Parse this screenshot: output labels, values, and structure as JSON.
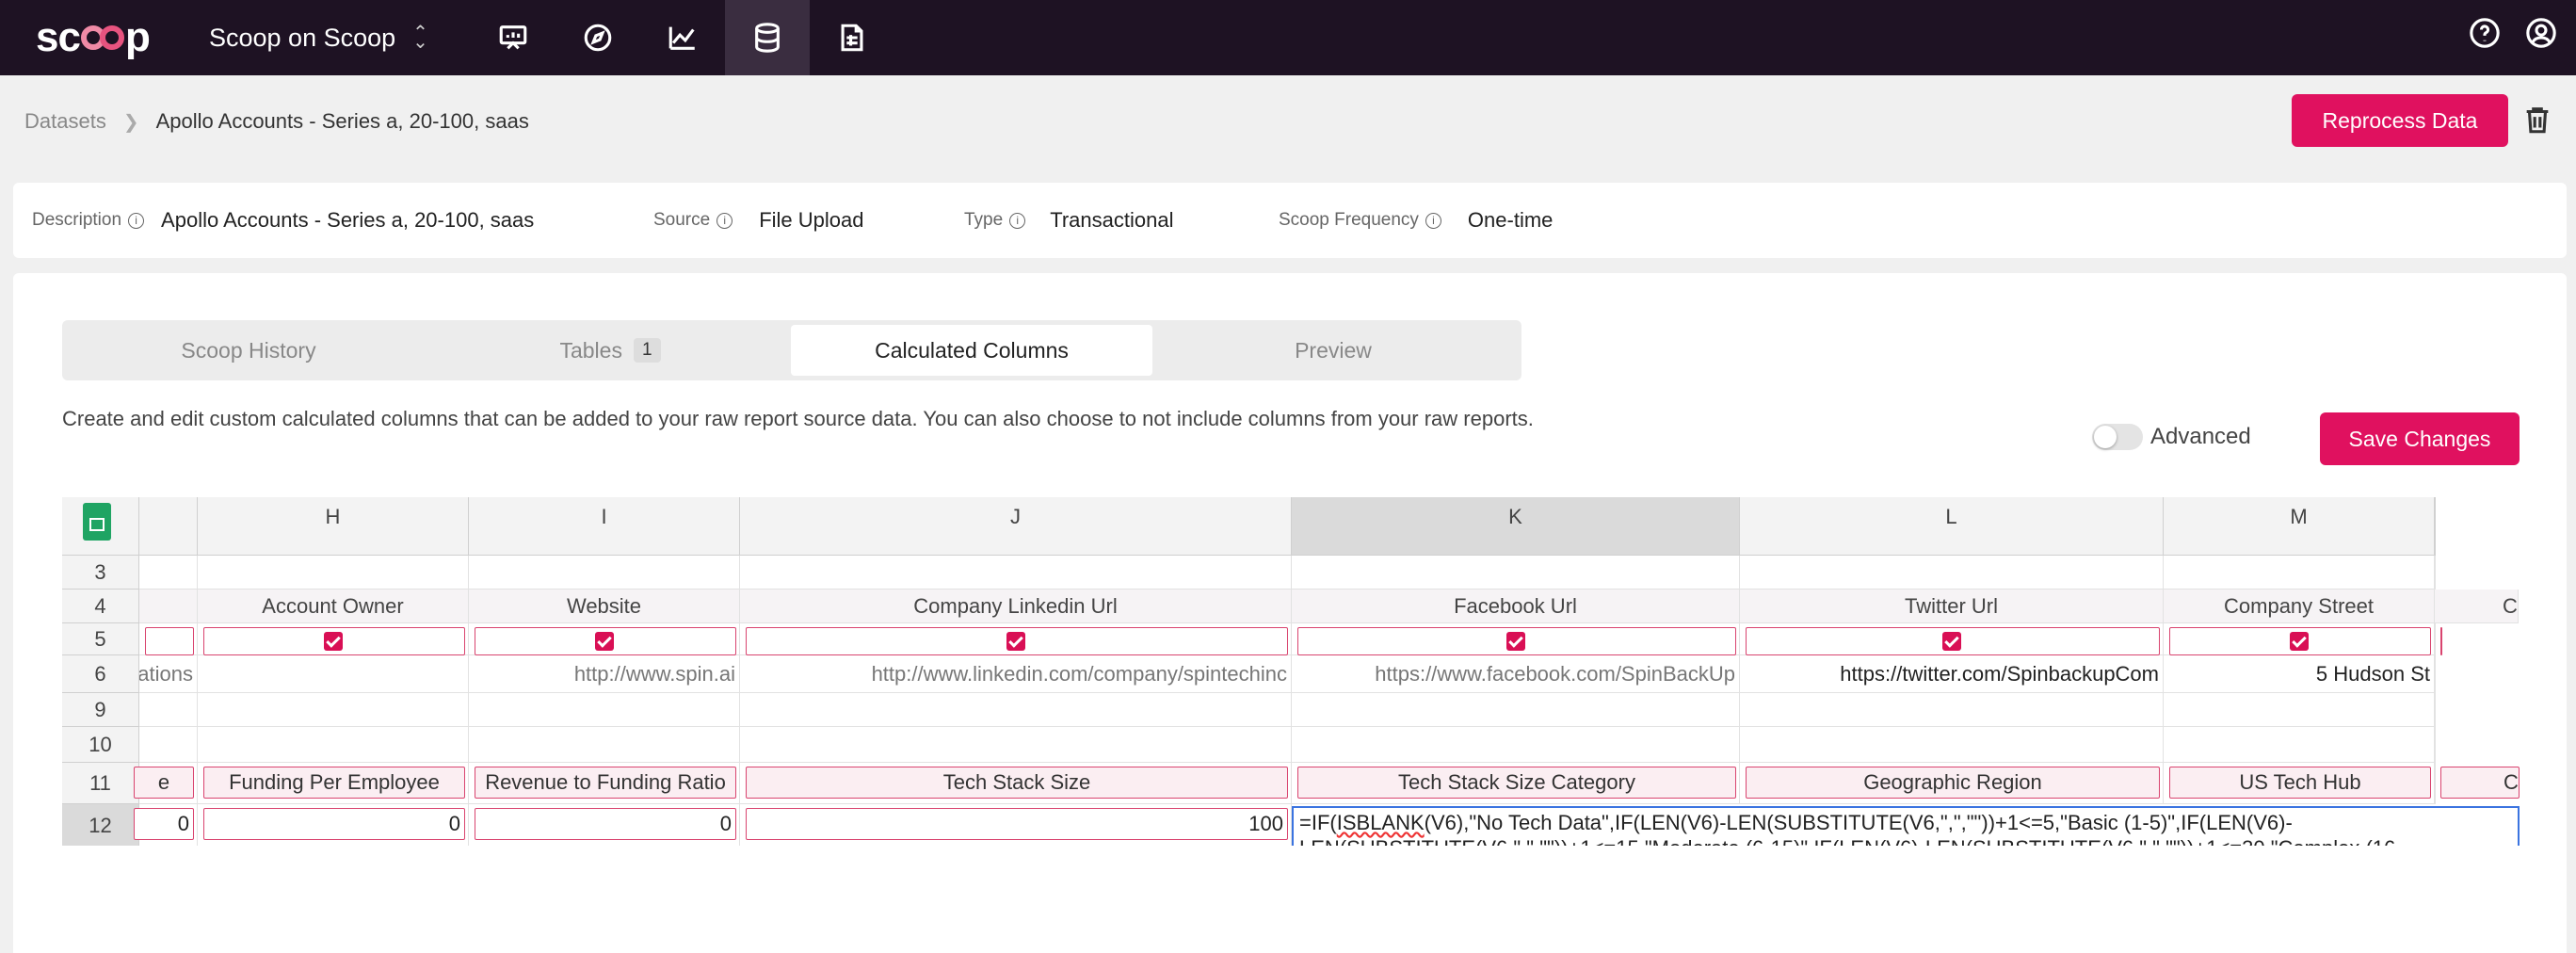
{
  "nav": {
    "logo": "scoop",
    "app_name": "Scoop on Scoop",
    "icons": [
      "presentation-icon",
      "compass-icon",
      "line-chart-icon",
      "database-icon",
      "report-icon"
    ],
    "active_icon": "database-icon",
    "right_icons": [
      "help-icon",
      "account-icon"
    ]
  },
  "breadcrumb": {
    "root": "Datasets",
    "current": "Apollo Accounts - Series a, 20-100, saas"
  },
  "actions": {
    "reprocess_label": "Reprocess Data",
    "save_label": "Save Changes",
    "advanced_label": "Advanced",
    "advanced_on": false
  },
  "info": {
    "description_label": "Description",
    "description_value": "Apollo Accounts - Series a, 20-100, saas",
    "source_label": "Source",
    "source_value": "File Upload",
    "type_label": "Type",
    "type_value": "Transactional",
    "frequency_label": "Scoop Frequency",
    "frequency_value": "One-time"
  },
  "tabs": [
    {
      "label": "Scoop History"
    },
    {
      "label": "Tables",
      "badge": "1"
    },
    {
      "label": "Calculated Columns",
      "active": true
    },
    {
      "label": "Preview"
    }
  ],
  "description_text": "Create and edit custom calculated columns that can be added to your raw report source data. You can also choose to not include columns from your raw reports.",
  "sheet": {
    "columns": [
      "H",
      "I",
      "J",
      "K",
      "L",
      "M"
    ],
    "row_numbers": [
      "3",
      "4",
      "5",
      "6",
      "9",
      "10",
      "11",
      "12"
    ],
    "row4_headers": [
      "Account Owner",
      "Website",
      "Company Linkedin Url",
      "Facebook Url",
      "Twitter Url",
      "Company Street"
    ],
    "row4_partial_right": "C",
    "row6_partial_left": "ations",
    "row6_values": [
      "",
      "http://www.spin.ai",
      "http://www.linkedin.com/company/spintechinc",
      "https://www.facebook.com/SpinBackUp",
      "https://twitter.com/SpinbackupCom",
      "5 Hudson St"
    ],
    "row11_partial_left": "e",
    "row11_calc_names": [
      "Funding Per Employee",
      "Revenue to Funding Ratio",
      "Tech Stack Size",
      "Tech Stack Size Category",
      "Geographic Region",
      "US Tech Hub"
    ],
    "row11_partial_right": "C",
    "row12_partial_left_value": "0",
    "row12_values": [
      "0",
      "0",
      "100"
    ],
    "formula_line1_a": "=IF(",
    "formula_line1_underlined": "ISBLANK",
    "formula_line1_b": "(V6),\"No Tech Data\",IF(LEN(V6)-LEN(SUBSTITUTE(V6,\",\",\"\"))+1<=5,\"Basic (1-5)\",IF(LEN(V6)-",
    "formula_line2": "LEN(SUBSTITUTE(V6,\",\",\"\"))+1<=15,\"Moderate (6-15)\",IF(LEN(V6)-LEN(SUBSTITUTE(V6,\",\",\"\"))+1<=30,\"Complex (16-"
  }
}
